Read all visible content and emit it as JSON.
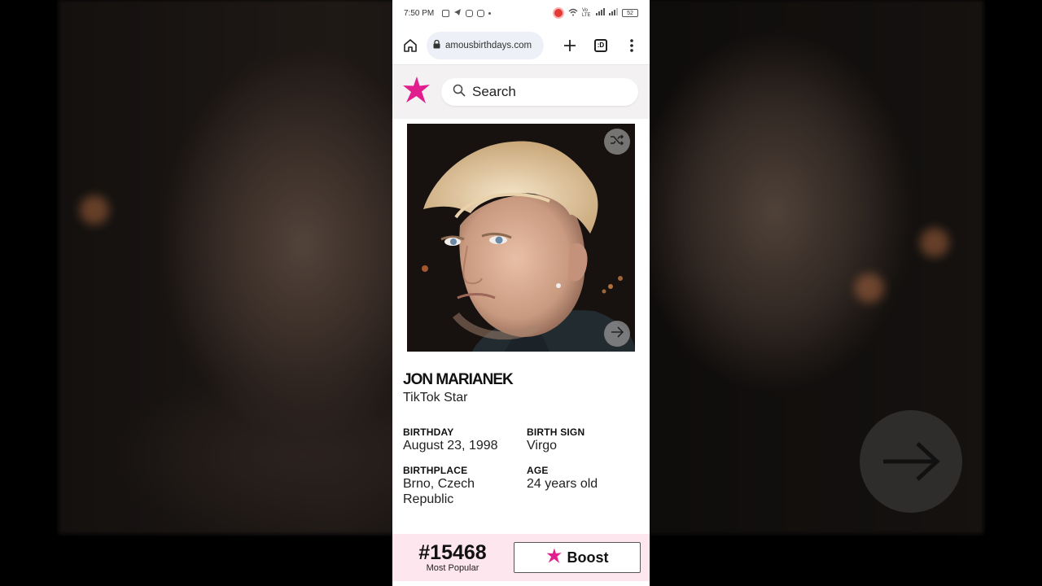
{
  "status_bar": {
    "time": "7:50 PM",
    "network": "Vo LTE",
    "battery": "52"
  },
  "browser": {
    "url": "amousbirthdays.com",
    "tab_count": ":D"
  },
  "site": {
    "search_placeholder": "Search",
    "brand_color": "#e21e8e"
  },
  "profile": {
    "name": "JON MARIANEK",
    "profession": "TikTok Star",
    "birthday_label": "BIRTHDAY",
    "birthday": "August 23, 1998",
    "birth_sign_label": "BIRTH SIGN",
    "birth_sign": "Virgo",
    "birthplace_label": "BIRTHPLACE",
    "birthplace": "Brno, Czech Republic",
    "age_label": "AGE",
    "age": "24 years old"
  },
  "popularity": {
    "rank": "#15468",
    "label": "Most Popular",
    "boost_label": "Boost"
  }
}
